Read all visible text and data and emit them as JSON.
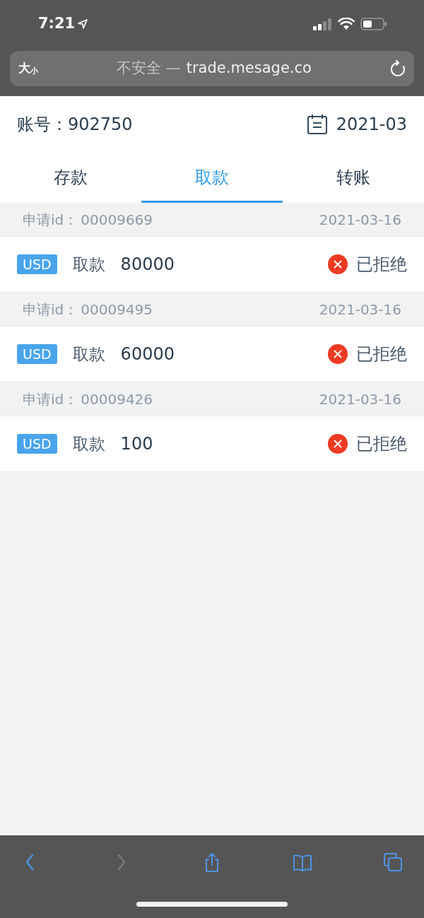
{
  "status_bar": {
    "time": "7:21"
  },
  "address_bar": {
    "text_size_button": "大",
    "text_size_small": "小",
    "security": "不安全 —",
    "domain": "trade.mesage.co"
  },
  "header": {
    "account_label": "账号：",
    "account_number": "902750",
    "month": "2021-03"
  },
  "tabs": [
    {
      "label": "存款",
      "selected": false
    },
    {
      "label": "取款",
      "selected": true
    },
    {
      "label": "转账",
      "selected": false
    }
  ],
  "records": [
    {
      "id_label": "申请id：",
      "id": "00009669",
      "date": "2021-03-16",
      "currency": "USD",
      "type": "取款",
      "amount": "80000",
      "status": "已拒绝",
      "kind": "rejected"
    },
    {
      "id_label": "申请id：",
      "id": "00009495",
      "date": "2021-03-16",
      "currency": "USD",
      "type": "取款",
      "amount": "60000",
      "status": "已拒绝",
      "kind": "rejected"
    },
    {
      "id_label": "申请id：",
      "id": "00009426",
      "date": "2021-03-16",
      "currency": "USD",
      "type": "取款",
      "amount": "100",
      "status": "已拒绝",
      "kind": "rejected"
    }
  ],
  "toolbar": [
    {
      "kind": "back",
      "disabled": false
    },
    {
      "kind": "forward",
      "disabled": true
    },
    {
      "kind": "share",
      "disabled": false
    },
    {
      "kind": "bookmarks",
      "disabled": false
    },
    {
      "kind": "tabs",
      "disabled": false
    }
  ]
}
